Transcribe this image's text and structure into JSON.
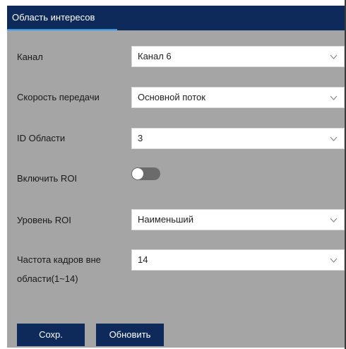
{
  "header": {
    "tab_title": "Область интересов"
  },
  "form": {
    "channel": {
      "label": "Канал",
      "value": "Канал 6"
    },
    "stream": {
      "label": "Скорость передачи",
      "value": "Основной поток"
    },
    "area_id": {
      "label": "ID Области",
      "value": "3"
    },
    "enable_roi": {
      "label": "Включить ROI",
      "enabled": false
    },
    "roi_level": {
      "label": "Уровень ROI",
      "value": "Наименьший"
    },
    "fps_outside": {
      "label_line1": "Частота кадров вне",
      "label_line2": "области(1~14)",
      "value": "14"
    }
  },
  "buttons": {
    "save": "Сохр.",
    "refresh": "Обновить"
  },
  "icons": {
    "dropdown": "chevron-down-icon"
  },
  "colors": {
    "header_bg": "#0d2a5a",
    "tab_underline": "#2d9bf0",
    "panel_bg": "#a5a5a5",
    "button_bg": "#0d2a5a",
    "toggle_off": "#6b6b6b"
  }
}
